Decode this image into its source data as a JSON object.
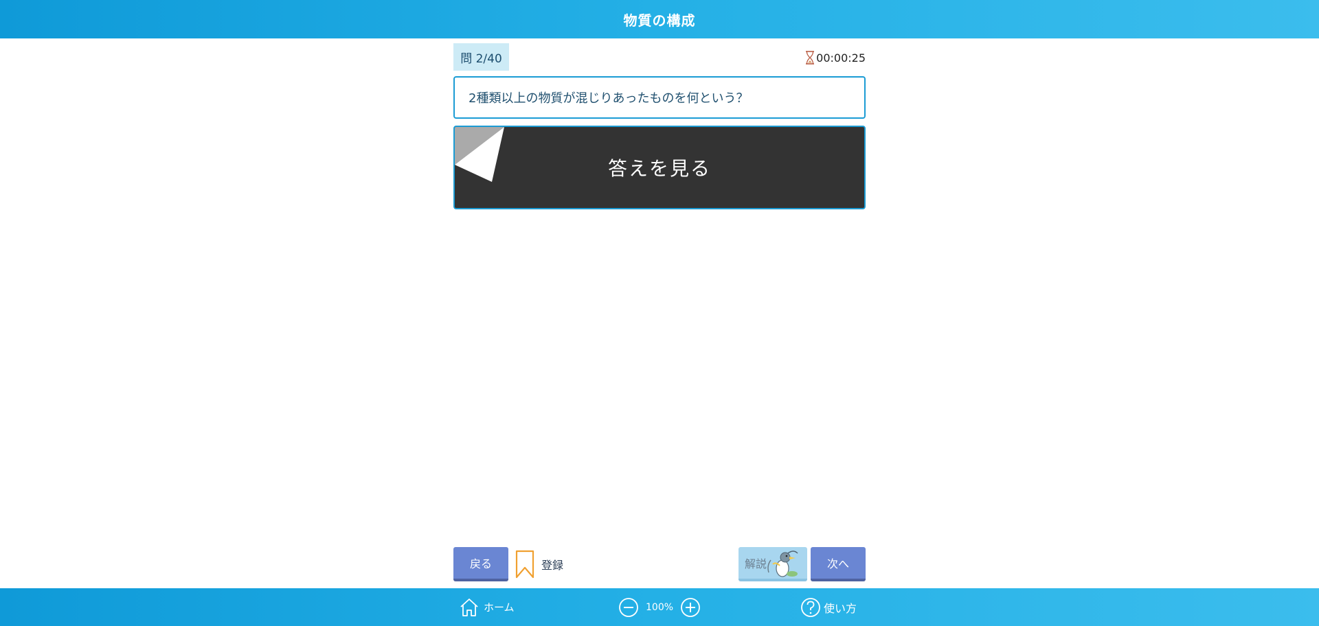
{
  "header": {
    "title": "物質の構成"
  },
  "quiz": {
    "question_number": "問 2/40",
    "timer": "00:00:25",
    "question": "2種類以上の物質が混じりあったものを何という？",
    "reveal_label": "答えを見る"
  },
  "actions": {
    "back_label": "戻る",
    "bookmark_label": "登録",
    "explain_label": "解説",
    "next_label": "次へ"
  },
  "footer": {
    "home_label": "ホーム",
    "zoom_level": "100%",
    "help_label": "使い方"
  },
  "colors": {
    "bar_blue": "#1a9bd4",
    "button_blue": "#6a86d3",
    "bookmark_orange": "#f0a030",
    "reveal_dark": "#333333"
  },
  "icons": [
    "hourglass-icon",
    "bookmark-icon",
    "bird-mascot-icon",
    "home-icon",
    "zoom-out-icon",
    "zoom-in-icon",
    "help-icon"
  ]
}
